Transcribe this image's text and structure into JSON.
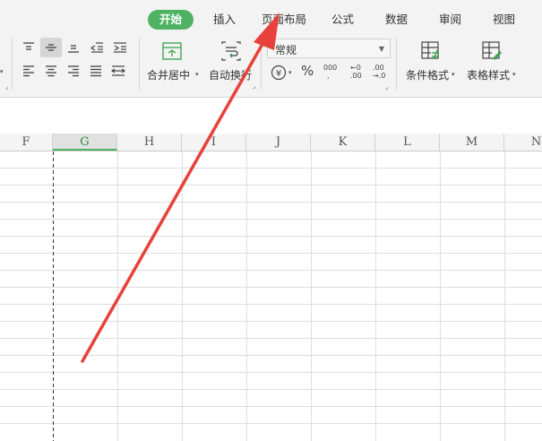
{
  "tabs": [
    {
      "label": "开始",
      "active": true
    },
    {
      "label": "插入",
      "active": false
    },
    {
      "label": "页面布局",
      "active": false
    },
    {
      "label": "公式",
      "active": false
    },
    {
      "label": "数据",
      "active": false
    },
    {
      "label": "审阅",
      "active": false
    },
    {
      "label": "视图",
      "active": false
    }
  ],
  "toolbar": {
    "merge_center": "合并居中",
    "auto_wrap": "自动换行",
    "number_format": "常规",
    "percent": "%",
    "thousands": "000",
    "inc_decimal_top": "←0",
    "inc_decimal_bottom": ".00",
    "dec_decimal_top": ".00",
    "dec_decimal_bottom": "→.0",
    "conditional_format": "条件格式",
    "table_style": "表格样式"
  },
  "sheet": {
    "columns": [
      "F",
      "G",
      "H",
      "I",
      "J",
      "K",
      "L",
      "M",
      "N"
    ],
    "selected_column": "G"
  },
  "colors": {
    "accent": "#4fb262",
    "arrow": "#e8403a",
    "ribbon_bg": "#f3f3f3",
    "gridline": "#dedede"
  }
}
